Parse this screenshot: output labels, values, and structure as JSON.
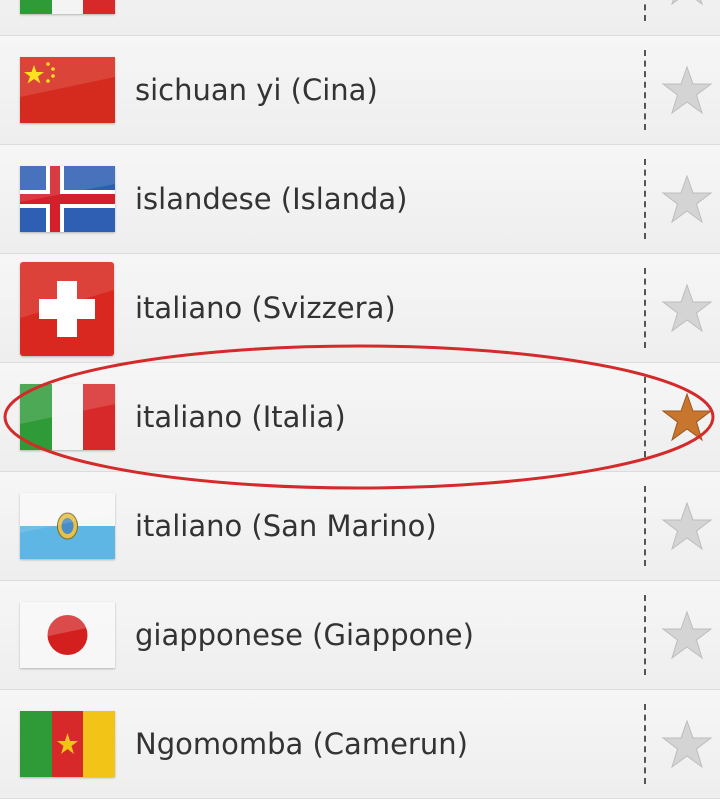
{
  "languages": [
    {
      "label": "",
      "flag": "italy",
      "favorite": false
    },
    {
      "label": "sichuan yi (Cina)",
      "flag": "china",
      "favorite": false
    },
    {
      "label": "islandese (Islanda)",
      "flag": "iceland",
      "favorite": false
    },
    {
      "label": "italiano (Svizzera)",
      "flag": "switzerland",
      "favorite": false
    },
    {
      "label": "italiano (Italia)",
      "flag": "italy",
      "favorite": true
    },
    {
      "label": "italiano (San Marino)",
      "flag": "san-marino",
      "favorite": false
    },
    {
      "label": "giapponese (Giappone)",
      "flag": "japan",
      "favorite": false
    },
    {
      "label": "Ngomomba (Camerun)",
      "flag": "cameroon",
      "favorite": false
    }
  ],
  "colors": {
    "favorite_star": "#c8752e",
    "unfavorite_star": "#d4d4d4",
    "highlight_ellipse": "#d42a2a"
  }
}
